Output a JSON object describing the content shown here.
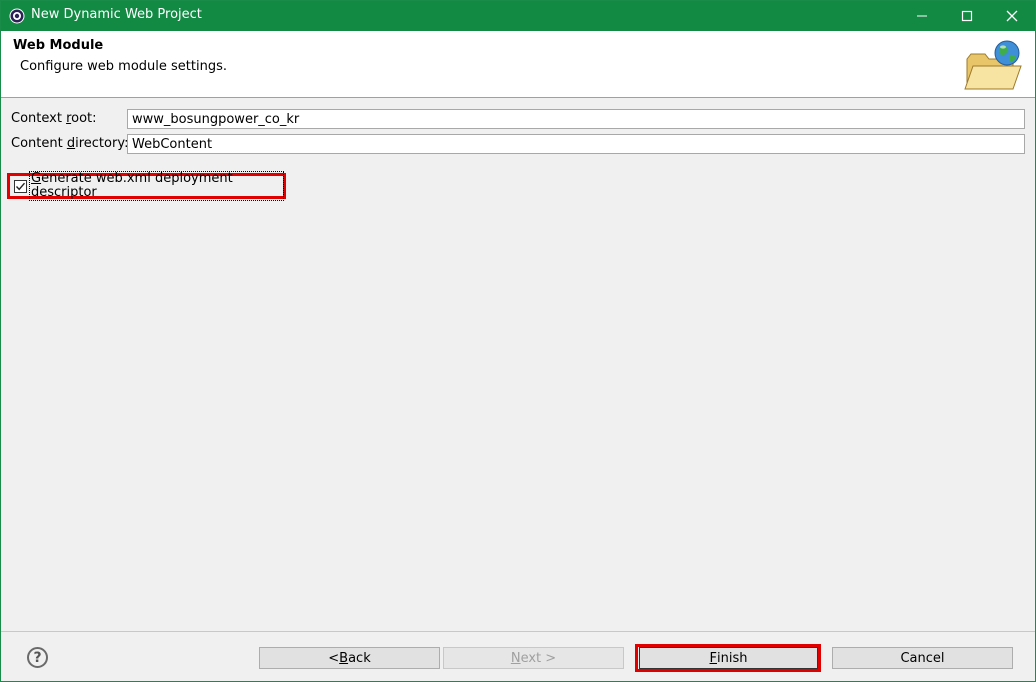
{
  "window": {
    "title": "New Dynamic Web Project",
    "accent_color": "#128a43",
    "controls": [
      "minimize-icon",
      "maximize-icon",
      "close-icon"
    ]
  },
  "header": {
    "title": "Web Module",
    "description": "Configure web module settings.",
    "icon": "folder-globe-icon"
  },
  "form": {
    "context_root_label_pre": "Context ",
    "context_root_label_mn": "r",
    "context_root_label_post": "oot:",
    "context_root_value": "www_bosungpower_co_kr",
    "content_dir_label_pre": "Content ",
    "content_dir_label_mn": "d",
    "content_dir_label_post": "irectory:",
    "content_dir_value": "WebContent",
    "generate_label_mn": "G",
    "generate_label_rest": "enerate web.xml deployment descriptor",
    "generate_checked": true
  },
  "highlight_color": "#e00000",
  "footer": {
    "help_glyph": "?",
    "back_pre": "< ",
    "back_mn": "B",
    "back_post": "ack",
    "next_mn": "N",
    "next_post": "ext >",
    "finish_mn": "F",
    "finish_post": "inish",
    "cancel_label": "Cancel"
  }
}
